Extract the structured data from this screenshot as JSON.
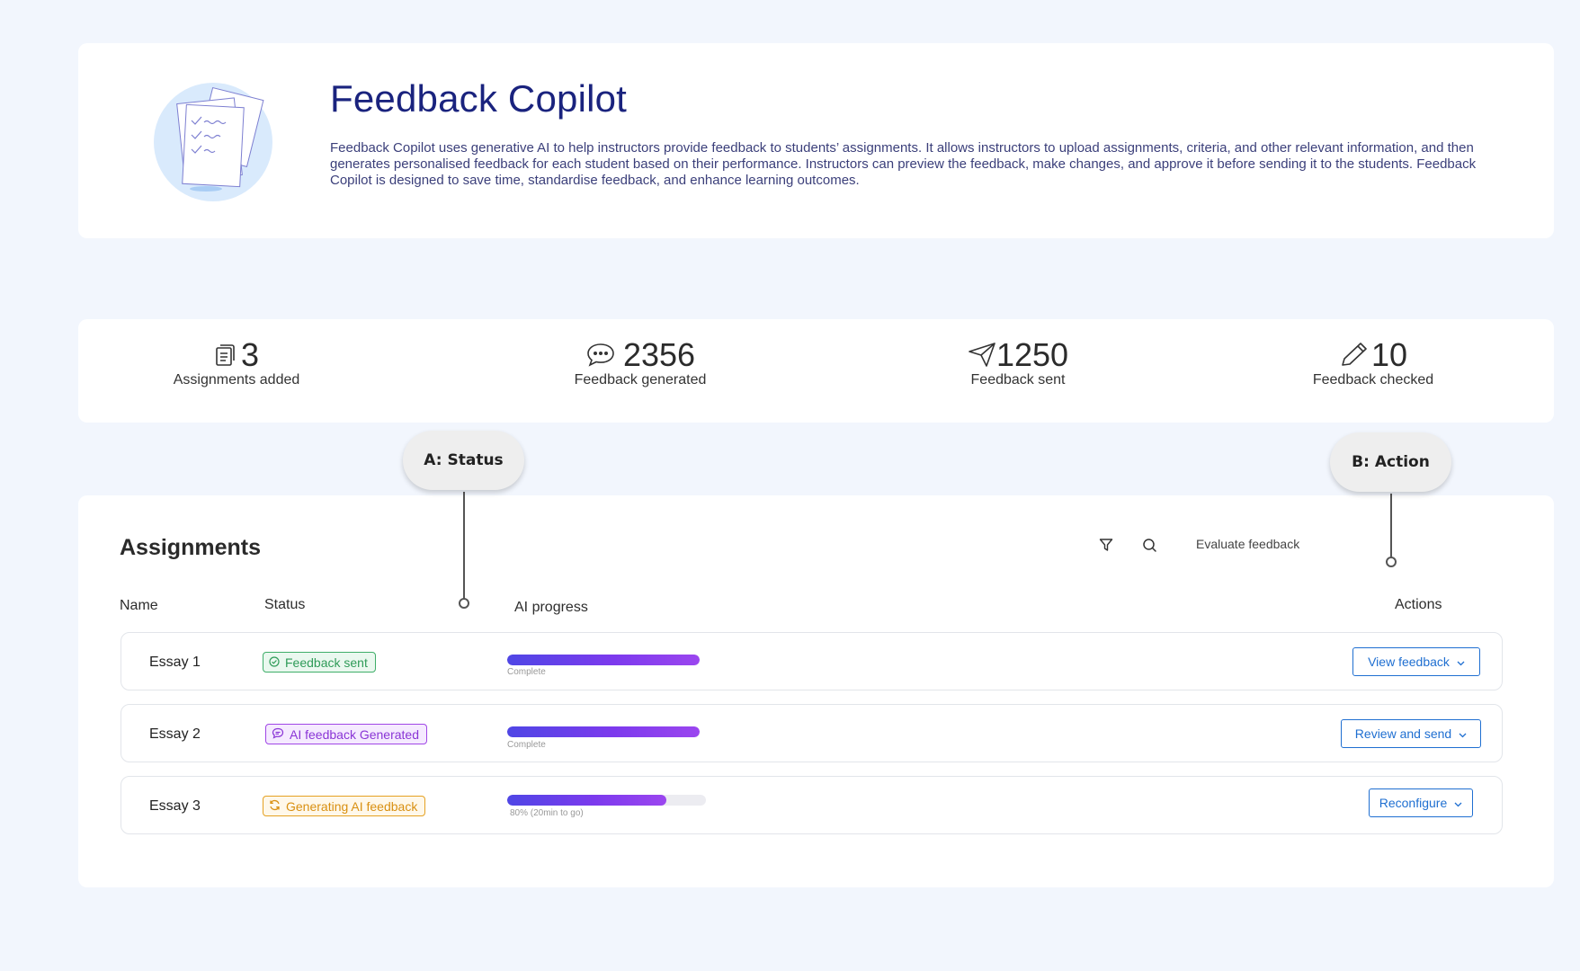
{
  "header": {
    "title": "Feedback Copilot",
    "description": "Feedback Copilot  uses generative AI to help instructors provide feedback to students’ assignments. It allows instructors to upload assignments, criteria, and other relevant information, and then generates personalised feedback for each student based on their performance. Instructors can preview the feedback, make changes, and approve it before sending it to the students. Feedback Copilot is designed to save time, standardise feedback, and enhance learning outcomes.",
    "illustration_icon": "documents-checklist-icon"
  },
  "stats": [
    {
      "icon": "document-icon",
      "value": "3",
      "label": "Assignments added"
    },
    {
      "icon": "chat-bubble-icon",
      "value": "2356",
      "label": "Feedback generated"
    },
    {
      "icon": "send-icon",
      "value": "1250",
      "label": "Feedback sent"
    },
    {
      "icon": "pencil-icon",
      "value": "10",
      "label": "Feedback checked"
    }
  ],
  "assignments": {
    "title": "Assignments",
    "toolbar": {
      "filter_icon": "filter-icon",
      "search_icon": "search-icon",
      "evaluate_label": "Evaluate feedback"
    },
    "columns": {
      "name": "Name",
      "status": "Status",
      "progress": "AI progress",
      "actions": "Actions"
    },
    "rows": [
      {
        "name": "Essay 1",
        "status": "Feedback sent",
        "status_icon": "check-circle-icon",
        "progress": 1.0,
        "progress_caption": "Complete",
        "action": "View feedback"
      },
      {
        "name": "Essay 2",
        "status": "AI feedback Generated",
        "status_icon": "chat-bubble-icon",
        "progress": 1.0,
        "progress_caption": "Complete",
        "action": "Review and send"
      },
      {
        "name": "Essay 3",
        "status": "Generating AI feedback",
        "status_icon": "refresh-icon",
        "progress": 0.8,
        "progress_caption": "80% (20min to go)",
        "action": "Reconfigure"
      }
    ]
  },
  "callouts": {
    "a": "A: Status",
    "b": "B: Action"
  },
  "colors": {
    "brand_title": "#1a237e",
    "accent_blue": "#1f6fd1",
    "status_sent": "#2f9b58",
    "status_generated": "#8a35d6",
    "status_generating": "#d99012",
    "progress_start": "#4f46e5",
    "progress_end": "#9b46ef"
  }
}
